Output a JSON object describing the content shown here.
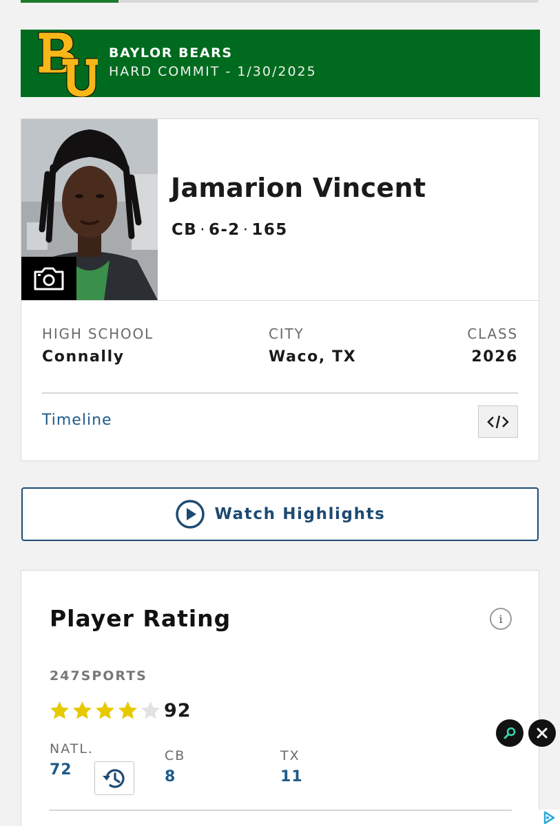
{
  "banner": {
    "team": "BAYLOR BEARS",
    "commit": "HARD COMMIT - 1/30/2025",
    "bg_color": "#006b1e",
    "logo_color": "#f7b718",
    "logo_icon": "baylor-bu-logo"
  },
  "player": {
    "name": "Jamarion Vincent",
    "position": "CB",
    "height": "6-2",
    "weight": "165",
    "photo_icon": "camera-icon"
  },
  "details": {
    "high_school_label": "HIGH SCHOOL",
    "high_school": "Connally",
    "city_label": "CITY",
    "city": "Waco, TX",
    "class_label": "CLASS",
    "class_year": "2026"
  },
  "links": {
    "timeline": "Timeline",
    "embed_icon": "code-embed-icon"
  },
  "highlights": {
    "label": "Watch Highlights",
    "icon": "play-circle-icon"
  },
  "rating": {
    "title": "Player Rating",
    "info_glyph": "i",
    "source": "247SPORTS",
    "stars_filled": 4,
    "stars_total": 5,
    "score": "92",
    "star_color": "#e7c900",
    "ranks": [
      {
        "label": "NATL.",
        "value": "72"
      },
      {
        "label": "CB",
        "value": "8"
      },
      {
        "label": "TX",
        "value": "11"
      }
    ],
    "history_icon": "history-icon"
  },
  "accent_color": "#1e5a8a"
}
